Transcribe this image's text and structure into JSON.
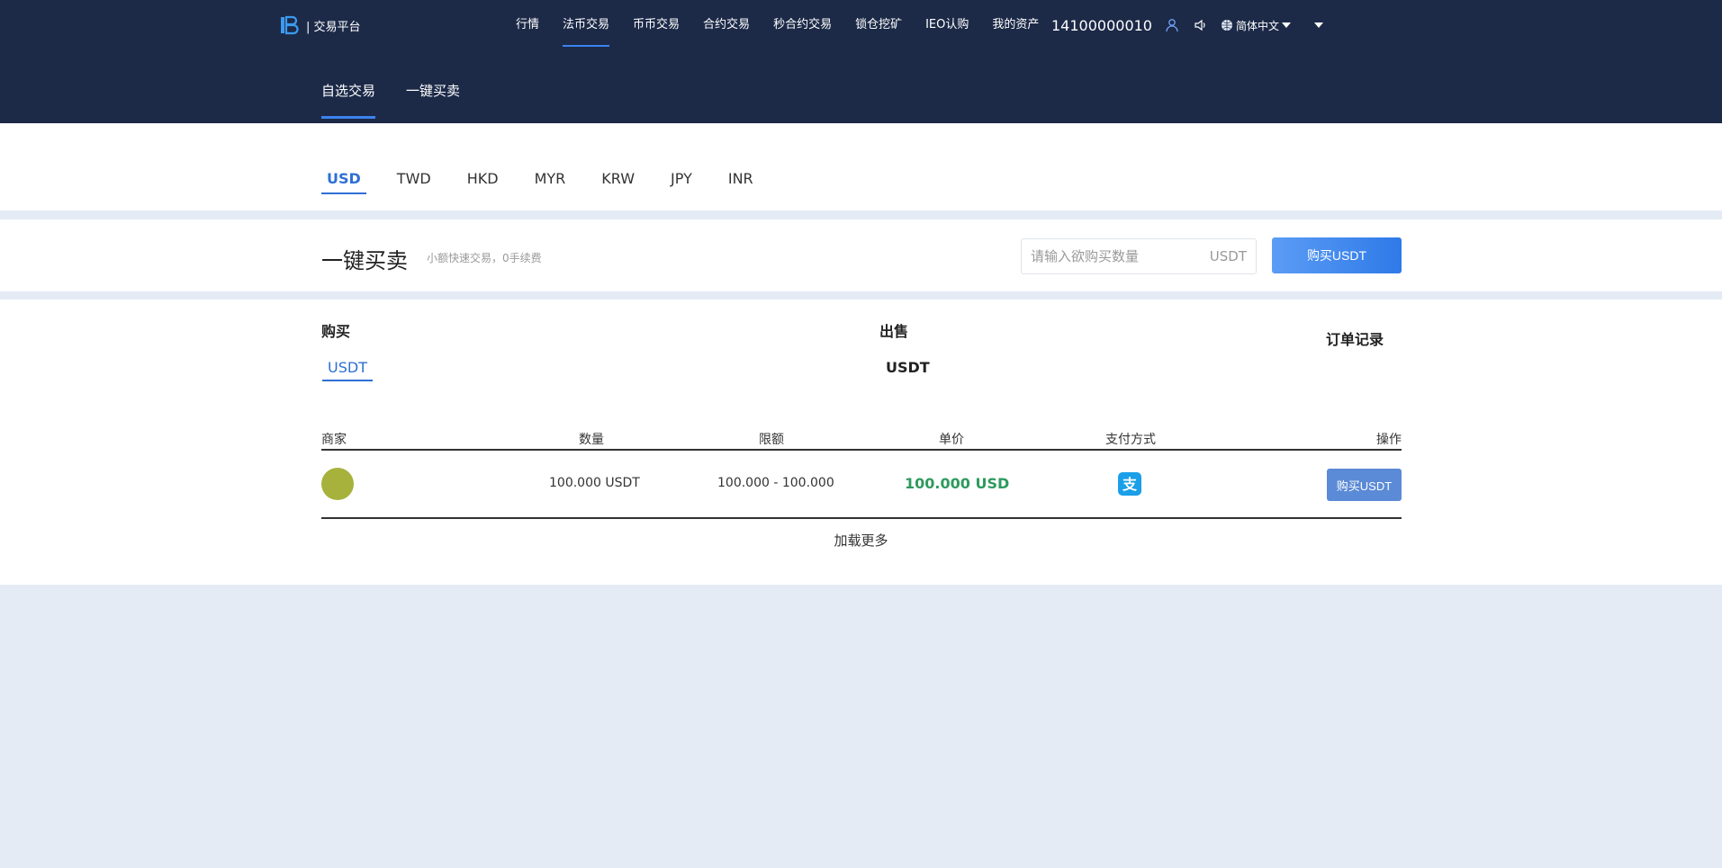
{
  "header": {
    "logo_text": "| 交易平台",
    "nav": [
      "行情",
      "法币交易",
      "币币交易",
      "合约交易",
      "秒合约交易",
      "锁仓挖矿",
      "IEO认购",
      "我的资产"
    ],
    "active_nav": 1,
    "account": "14100000010",
    "language": "简体中文",
    "subtabs": [
      "自选交易",
      "一键买卖"
    ],
    "active_subtab": 0
  },
  "currencies": {
    "items": [
      "USD",
      "TWD",
      "HKD",
      "MYR",
      "KRW",
      "JPY",
      "INR"
    ],
    "active": 0
  },
  "quick": {
    "title": "一键买卖",
    "subtitle": "小额快速交易，0手续费",
    "input_placeholder": "请输入欲购买数量",
    "unit": "USDT",
    "button": "购买USDT"
  },
  "market": {
    "buy_label": "购买",
    "sell_label": "出售",
    "buy_coin": "USDT",
    "sell_coin": "USDT",
    "orders_label": "订单记录",
    "columns": [
      "商家",
      "数量",
      "限额",
      "单价",
      "支付方式",
      "操作"
    ],
    "rows": [
      {
        "quantity": "100.000 USDT",
        "limit": "100.000 - 100.000",
        "price": "100.000 USD",
        "payment": "alipay-icon",
        "action": "购买USDT"
      }
    ],
    "load_more": "加载更多"
  },
  "colors": {
    "header_bg": "#1c2a48",
    "accent": "#2f6fd6",
    "price": "#2e9a5e",
    "avatar": "#a6b23c",
    "page_bg": "#e4ebf5"
  }
}
